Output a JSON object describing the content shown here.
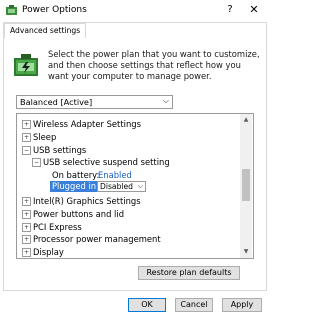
{
  "window": {
    "title": "Power Options",
    "help_label": "?",
    "close_label": "✕"
  },
  "tabs": [
    {
      "label": "Advanced settings"
    }
  ],
  "intro_text": "Select the power plan that you want to customize, and then choose settings that reflect how you want your computer to manage power.",
  "plan_select": {
    "value": "Balanced [Active]"
  },
  "tree": {
    "items": [
      {
        "label": "Wireless Adapter Settings",
        "expander": "+"
      },
      {
        "label": "Sleep",
        "expander": "+"
      },
      {
        "label": "USB settings",
        "expander": "−"
      },
      {
        "label": "USB selective suspend setting",
        "expander": "−"
      },
      {
        "label": "On battery:",
        "value": "Enabled"
      },
      {
        "label": "Plugged in:",
        "value": "Disabled"
      },
      {
        "label": "Intel(R) Graphics Settings",
        "expander": "+"
      },
      {
        "label": "Power buttons and lid",
        "expander": "+"
      },
      {
        "label": "PCI Express",
        "expander": "+"
      },
      {
        "label": "Processor power management",
        "expander": "+"
      },
      {
        "label": "Display",
        "expander": "+"
      }
    ]
  },
  "buttons": {
    "restore": "Restore plan defaults",
    "ok": "OK",
    "cancel": "Cancel",
    "apply": "Apply"
  },
  "colors": {
    "accent": "#0078d7",
    "selection": "#3a80d9",
    "link": "#1a5fc0"
  }
}
